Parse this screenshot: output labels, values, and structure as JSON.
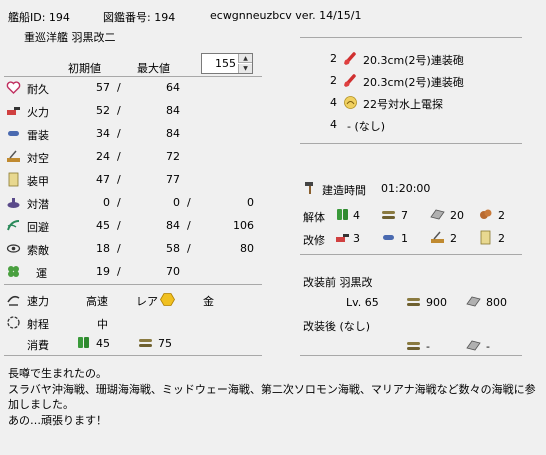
{
  "header": {
    "ship_id": "艦船ID:  194",
    "zukan": "図鑑番号:  194",
    "version": "ecwgnneuzbcv ver. 14/15/1",
    "ship_name": "重巡洋艦  羽黒改二"
  },
  "stats": {
    "col_initial": "初期値",
    "col_max": "最大値",
    "level": "155",
    "rows": [
      {
        "icon": "heart-icon",
        "label": "耐久",
        "a": "57",
        "s1": "/",
        "b": "64",
        "c": ""
      },
      {
        "icon": "firepower-icon",
        "label": "火力",
        "a": "52",
        "s1": "/",
        "b": "84",
        "c": ""
      },
      {
        "icon": "torpedo-icon",
        "label": "雷装",
        "a": "34",
        "s1": "/",
        "b": "84",
        "c": ""
      },
      {
        "icon": "antiair-icon",
        "label": "対空",
        "a": "24",
        "s1": "/",
        "b": "72",
        "c": ""
      },
      {
        "icon": "armor-icon",
        "label": "装甲",
        "a": "47",
        "s1": "/",
        "b": "77",
        "c": ""
      },
      {
        "icon": "asw-icon",
        "label": "対潜",
        "a": "0",
        "s1": "/",
        "b": "0",
        "c": "0"
      },
      {
        "icon": "evasion-icon",
        "label": "回避",
        "a": "45",
        "s1": "/",
        "b": "84",
        "c": "106"
      },
      {
        "icon": "los-icon",
        "label": "索敵",
        "a": "18",
        "s1": "/",
        "b": "58",
        "c": "80"
      },
      {
        "icon": "clover-icon",
        "label": "運",
        "a": "19",
        "s1": "/",
        "b": "70",
        "c": ""
      }
    ]
  },
  "misc": {
    "speed_label": "速力",
    "speed": "高速",
    "rarity_label": "レア",
    "rarity": "金",
    "range_label": "射程",
    "range": "中",
    "cost_label": "消費",
    "fuel": "45",
    "ammo": "75"
  },
  "equipment": [
    {
      "count": "2",
      "name": "20.3cm(2号)連装砲",
      "icon": "gun-icon"
    },
    {
      "count": "2",
      "name": "20.3cm(2号)連装砲",
      "icon": "gun-icon"
    },
    {
      "count": "4",
      "name": "22号対水上電探",
      "icon": "radar-icon"
    },
    {
      "count": "4",
      "name": "-  (なし)",
      "icon": ""
    }
  ],
  "build": {
    "label": "建造時間",
    "time": "01:20:00"
  },
  "dismantle": {
    "label": "解体",
    "fuel": "4",
    "ammo": "7",
    "steel": "20",
    "baux": "2"
  },
  "modern": {
    "label": "改修",
    "fire": "3",
    "torp": "1",
    "aa": "2",
    "armor": "2"
  },
  "remodel_before": {
    "label": "改装前  羽黒改",
    "level": "Lv. 65",
    "ammo": "900",
    "steel": "800"
  },
  "remodel_after": {
    "label": "改装後  (なし)",
    "ammo": "-",
    "steel": "-"
  },
  "description": "長噂で生まれたの。\nスラバヤ沖海戦、珊瑚海海戦、ミッドウェー海戦、第二次ソロモン海戦、マリアナ海戦など数々の海戦に参加しました。\nあの…頑張ります！",
  "colors": {
    "bg": "#f0f0f0",
    "divider": "#a8a8a8",
    "rarity_gold": "#f0c020"
  }
}
